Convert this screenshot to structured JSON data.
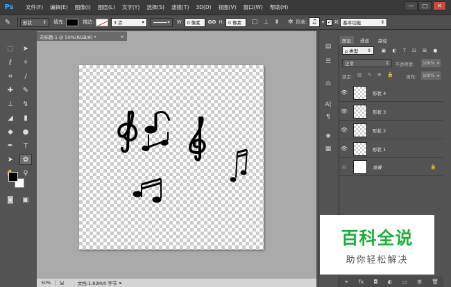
{
  "app": {
    "logo": "Ps"
  },
  "menu": [
    "文件(F)",
    "编辑(E)",
    "图像(I)",
    "图层(L)",
    "文字(Y)",
    "选择(S)",
    "滤镜(T)",
    "3D(D)",
    "视图(V)",
    "窗口(W)",
    "帮助(H)"
  ],
  "window_controls": {
    "minimize": "—",
    "maximize": "□",
    "close": "✕"
  },
  "options": {
    "tool_mode": "形状",
    "fill_label": "填充:",
    "stroke_label": "描边:",
    "stroke_size": "3 点",
    "w_label": "W:",
    "w_value": "0 像素",
    "link": "GO",
    "h_label": "H:",
    "h_value": "0 像素",
    "shape_label": "形状:",
    "align_label": "对",
    "workspace": "基本功能",
    "fill_color": "#000000"
  },
  "document": {
    "tab": "未标题-1 @ 50%(RGB/8) *",
    "zoom": "50%",
    "doc_info": "文档:1.83M/0 字节"
  },
  "panel": {
    "tabs": [
      "图层",
      "通道",
      "路径"
    ],
    "filter": "ρ 类型",
    "blend_mode": "正常",
    "opacity_label": "不透明度:",
    "opacity_value": "100%",
    "lock_label": "锁定:",
    "fill_label": "填充:",
    "fill_value": "100%",
    "layers": [
      {
        "name": "形状 4",
        "visible": "👁"
      },
      {
        "name": "形状 3",
        "visible": "👁"
      },
      {
        "name": "形状 2",
        "visible": "👁"
      },
      {
        "name": "形状 1",
        "visible": "👁"
      },
      {
        "name": "背景",
        "visible": ""
      }
    ],
    "footer_icons": [
      "link-icon",
      "fx-icon",
      "mask-icon",
      "adjustment-icon",
      "folder-icon",
      "new-layer-icon",
      "trash-icon"
    ]
  },
  "watermark": {
    "title": "百科全说",
    "subtitle": "助你轻松解决"
  },
  "colors": {
    "accent": "#31a8ff",
    "watermark_green": "#1fae3b"
  }
}
